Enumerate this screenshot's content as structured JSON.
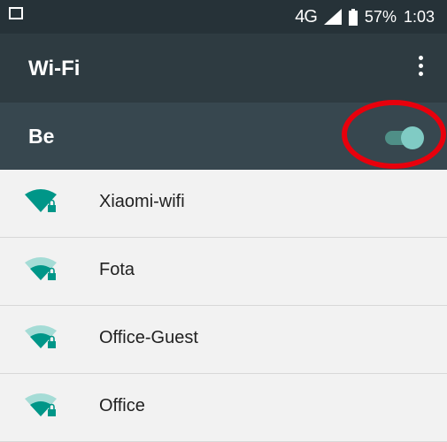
{
  "status_bar": {
    "network": "4G",
    "battery": "57%",
    "time": "1:03"
  },
  "toolbar": {
    "title": "Wi-Fi"
  },
  "master_switch": {
    "label": "Be",
    "state": "on",
    "accent_color": "#80cbc4"
  },
  "networks": [
    {
      "ssid": "Xiaomi-wifi",
      "signal": "full",
      "secured": true
    },
    {
      "ssid": "Fota",
      "signal": "medium",
      "secured": true
    },
    {
      "ssid": "Office-Guest",
      "signal": "medium",
      "secured": true
    },
    {
      "ssid": "Office",
      "signal": "medium",
      "secured": true
    }
  ],
  "colors": {
    "wifi_teal": "#009688",
    "wifi_faded": "#a5dcd6",
    "highlight_circle": "#e8000c"
  }
}
